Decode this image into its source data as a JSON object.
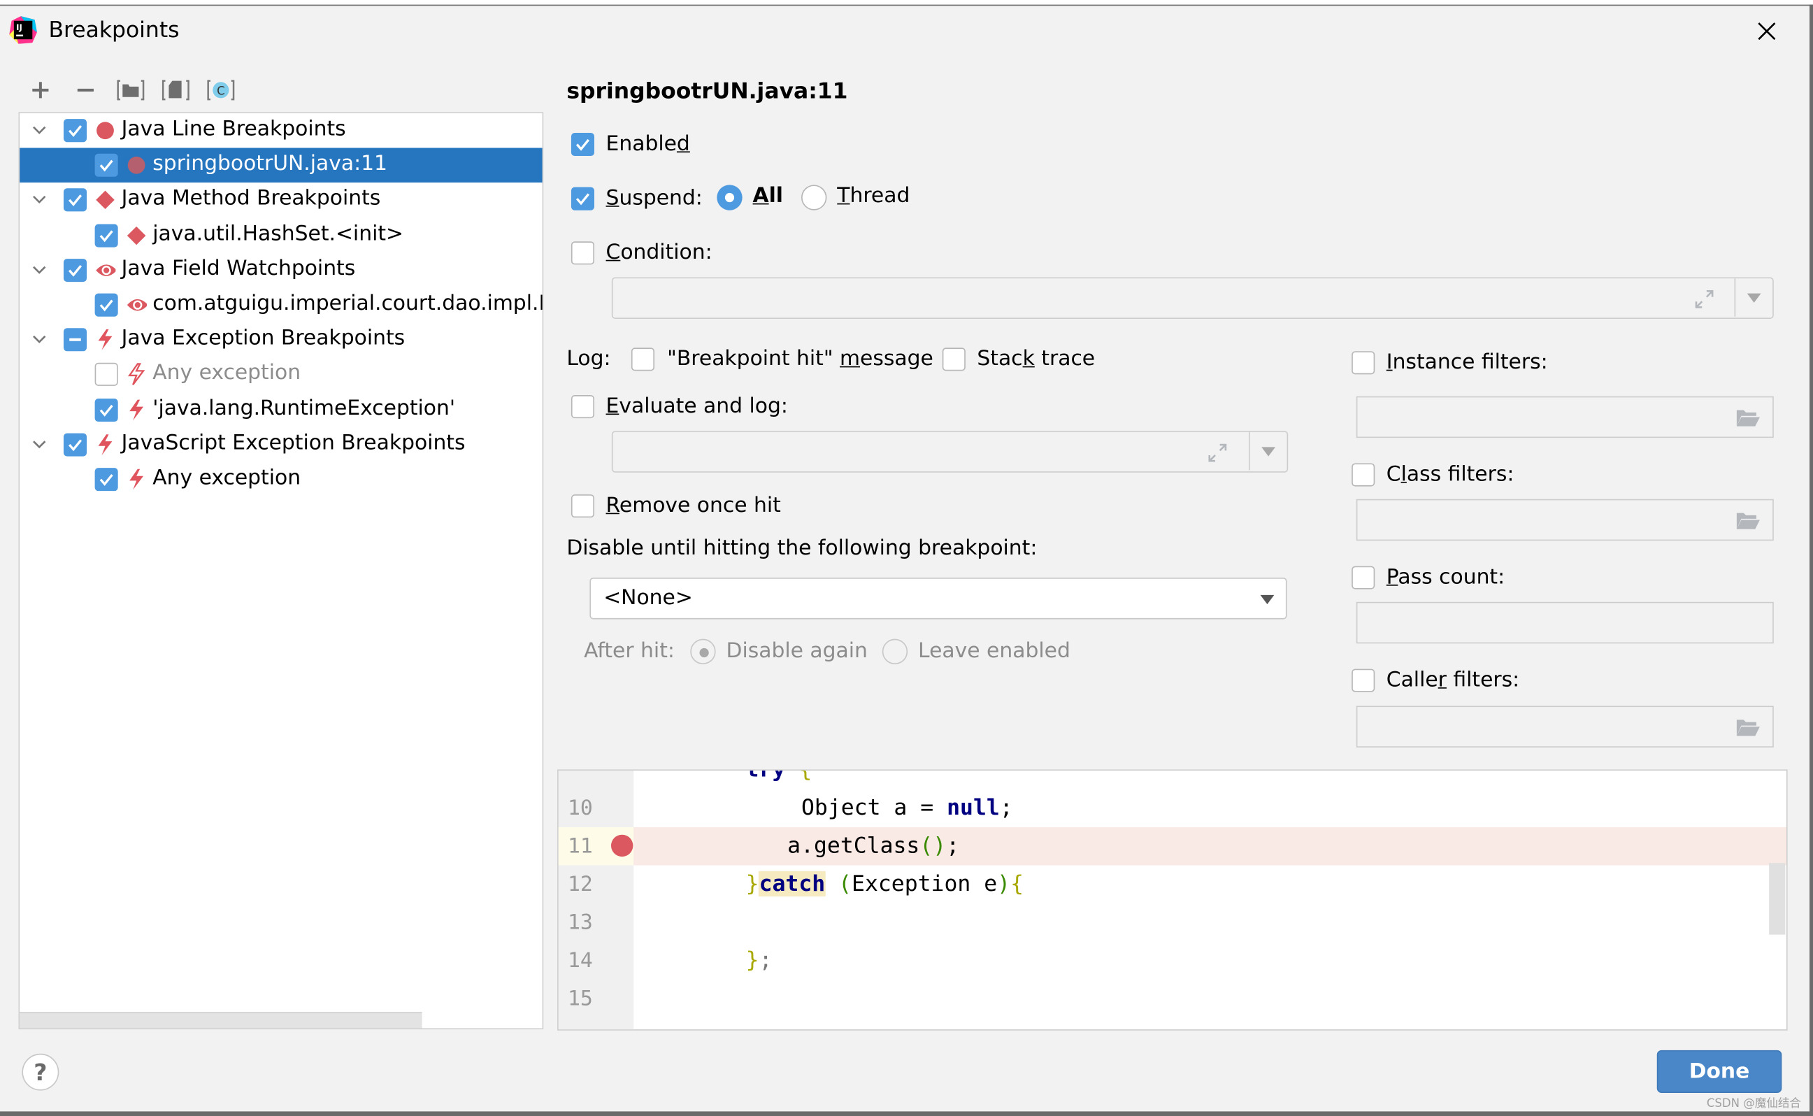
{
  "window": {
    "title": "Breakpoints",
    "app_icon": "intellij-idea-icon",
    "close_icon": "close-icon"
  },
  "toolbar": {
    "buttons": [
      {
        "name": "add-breakpoint-button",
        "icon": "plus-icon",
        "label": "+"
      },
      {
        "name": "remove-breakpoint-button",
        "icon": "minus-icon",
        "label": "−"
      },
      {
        "name": "group-by-package-button",
        "icon": "folder-bracket-icon"
      },
      {
        "name": "group-by-file-button",
        "icon": "file-bracket-icon"
      },
      {
        "name": "group-by-class-button",
        "icon": "class-bracket-icon",
        "glyph": "C"
      }
    ]
  },
  "tree": {
    "items": [
      {
        "label": "Java Line Breakpoints",
        "level": 0,
        "checked": "on",
        "icon": "red-circle-icon",
        "expanded": true
      },
      {
        "label": "springbootrUN.java:11",
        "level": 1,
        "checked": "on",
        "icon": "red-circle-icon",
        "selected": true
      },
      {
        "label": "Java Method Breakpoints",
        "level": 0,
        "checked": "on",
        "icon": "red-diamond-icon",
        "expanded": true
      },
      {
        "label": "java.util.HashSet.<init>",
        "level": 1,
        "checked": "on",
        "icon": "red-diamond-icon"
      },
      {
        "label": "Java Field Watchpoints",
        "level": 0,
        "checked": "on",
        "icon": "red-eye-icon",
        "expanded": true
      },
      {
        "label": "com.atguigu.imperial.court.dao.impl.Em",
        "level": 1,
        "checked": "on",
        "icon": "red-eye-icon"
      },
      {
        "label": "Java Exception Breakpoints",
        "level": 0,
        "checked": "partial",
        "icon": "lightning-icon",
        "expanded": true
      },
      {
        "label": "Any exception",
        "level": 1,
        "checked": "off",
        "icon": "lightning-outline-icon",
        "disabled": true
      },
      {
        "label": "'java.lang.RuntimeException'",
        "level": 1,
        "checked": "on",
        "icon": "lightning-icon"
      },
      {
        "label": "JavaScript Exception Breakpoints",
        "level": 0,
        "checked": "on",
        "icon": "lightning-icon",
        "expanded": true
      },
      {
        "label": "Any exception",
        "level": 1,
        "checked": "on",
        "icon": "lightning-icon"
      }
    ]
  },
  "details": {
    "title": "springbootrUN.java:11",
    "enabled": {
      "label_pre": "Enable",
      "label_u": "d",
      "label_post": "",
      "checked": true
    },
    "suspend": {
      "label_pre": "",
      "label_u": "S",
      "label_post": "uspend:",
      "checked": true
    },
    "suspend_all": {
      "label_u": "A",
      "label_post": "ll",
      "selected": true
    },
    "suspend_thread": {
      "label_u": "T",
      "label_post": "hread",
      "selected": false
    },
    "condition": {
      "label_u": "C",
      "label_post": "ondition:",
      "checked": false,
      "value": ""
    },
    "log_label": "Log:",
    "log_message": {
      "label_pre": "\"Breakpoint hit\" ",
      "label_u": "m",
      "label_post": "essage",
      "checked": false
    },
    "stack_trace": {
      "label_pre": "Stac",
      "label_u": "k",
      "label_post": " trace",
      "checked": false
    },
    "evaluate_and_log": {
      "label_u": "E",
      "label_post": "valuate and log:",
      "checked": false,
      "value": ""
    },
    "remove_once_hit": {
      "label_u": "R",
      "label_post": "emove once hit",
      "checked": false
    },
    "disable_until_label": "Disable until hitting the following breakpoint:",
    "disable_until_value": "<None>",
    "after_hit_label": "After hit:",
    "after_hit_disable_again": {
      "label": "Disable again",
      "selected": true
    },
    "after_hit_leave_enabled": {
      "label": "Leave enabled",
      "selected": false
    },
    "instance_filters": {
      "label_u": "I",
      "label_post": "nstance filters:",
      "checked": false,
      "value": ""
    },
    "class_filters": {
      "label_pre": "C",
      "label_u": "l",
      "label_post": "ass filters:",
      "checked": false,
      "value": ""
    },
    "pass_count": {
      "label_u": "P",
      "label_post": "ass count:",
      "checked": false,
      "value": ""
    },
    "caller_filters": {
      "label_pre": "Calle",
      "label_u": "r",
      "label_post": " filters:",
      "checked": false,
      "value": ""
    }
  },
  "editor": {
    "lines": [
      {
        "num": "",
        "text": "try {"
      },
      {
        "num": "10",
        "text": "Object a = null;"
      },
      {
        "num": "11",
        "text": "a.getClass();",
        "breakpoint": true
      },
      {
        "num": "12",
        "text": "}catch (Exception e){"
      },
      {
        "num": "13",
        "text": ""
      },
      {
        "num": "14",
        "text": "};"
      },
      {
        "num": "15",
        "text": ""
      }
    ]
  },
  "footer": {
    "help_label": "?",
    "done_label": "Done",
    "watermark": "CSDN @魔仙结合"
  },
  "colors": {
    "accent": "#4e9ae0",
    "selection": "#2675bf",
    "breakpoint_red": "#db5860",
    "done_button": "#4a87c8",
    "breakpoint_line_bg": "#faeae6"
  }
}
